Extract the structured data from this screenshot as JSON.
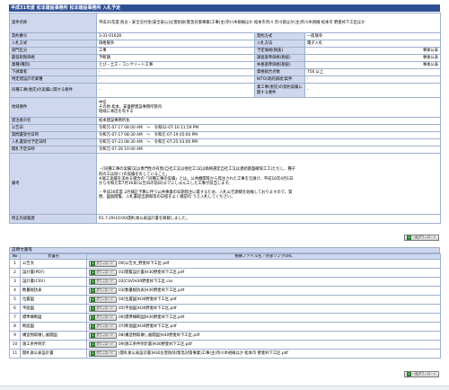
{
  "page_title": "平成31年度 松本建設事務所 松本建設事務所 入札予定",
  "rows": {
    "project_name_label": "案件名称",
    "project_name_value": "平成31年度 防災・安全交付金(安全安心)災害防除(緊急対策事業)工事(主)奈川木祖線ほか 松本市奈川 奈川渡ほか(主)奈川木祖線 松本市 野麦峠下工区ほか",
    "proc_no_label": "契約番号",
    "proc_no_value": "3-31-01628",
    "contract_method_label": "契約方式",
    "contract_method_value": "一般競争",
    "bid_type_label": "入札方式",
    "bid_type_value": "価格競争",
    "bid_method_label": "入札方法",
    "bid_method_value": "電子入札",
    "category_label": "部門区分",
    "category_value": "工事",
    "estimated_label": "予定価格(税抜)",
    "estimated_value": "",
    "estimated_note": "事後公表",
    "minimum_label": "最低制限価格",
    "minimum_value": "予断額",
    "survey_label": "調査基準価格(税抜)",
    "survey_note": "事後公表",
    "industry_label": "業種(種別)",
    "industry_value": "とび・土工・コンクリート工事",
    "lowlimit_label": "失格基準価格(税抜)",
    "lowlimit_note": "事後公表",
    "place_label": "下請業者",
    "place_value": "-",
    "qualification_label": "資格総合点数",
    "qualification_value": "756 以上",
    "special_label": "特定建設許可業種",
    "special_value": "-",
    "wto_label": "WTO(政府調達)案件",
    "wto_value": "-",
    "jv_label": "同種工事(委託)の実績に関する要件",
    "jv_value": "-",
    "jv2_label": "業工事(委託)の契約実績に関する要件",
    "jv2_value": "-",
    "region_label": "地域要件",
    "region_value": "中信\nその他 松本、安曇野建設事務所管内\n地域に本店を有する",
    "publisher_label": "発注者の名",
    "publisher_value": "松本建設事務所長",
    "announce_label": "公告日",
    "announce_value": "令和元-07-17 08:00 AM　〜　令和02-07-16 11:59 PM",
    "question_label": "質問書受付日時",
    "question_value": "令和元-07-17 08:30 AM　〜　令和元-07-19 05:00 PM",
    "bid_receive_label": "入札書受付予定日時",
    "bid_receive_value": "令和元-07-23 08:30 AM　〜　令和元-07-25 03:00 PM",
    "open_label": "開札予定日時",
    "open_value": "令和元-07-26 10:00 AM",
    "remarks_label": "備考",
    "remarks_value": "・[同種工事の実績]又は専門性の有無(自社工又は他社工)又は価格選定自社工又は連続基盤確保工工(ただし、種子的の工は除く)の実績を有していること。\n※施工実績を求める場合の「同種工事の実績」とは、公共機関等から発注された工事を元請け、平成16年4月1日から令和元年7月16日(公告日の前日)までにしゅん工した工事が該当します。\n\n・平成30年度 2月補正予算に伴う公共事業の早期発注に資するため、入札公告期間を短縮しておりますので、質問、図面閲覧、入札書提出期限等の日程をよく確認の うえ入札してください。",
    "modified_label": "修正内容履歴",
    "modified_value": "R1.7.29(10:00)開札後公表設計書を掲載しました。"
  },
  "docs": {
    "section_title": "説明文書等",
    "bulk_download_label": "一括ダウンロード",
    "col_no": "No",
    "col_title": "文書名",
    "col_file": "格納ファイル名／外部リンクURL",
    "download_label": "ダウンロード",
    "items": [
      {
        "no": "1",
        "title": "公告文",
        "file": "00[公告文_野麦峠下工区.pdf"
      },
      {
        "no": "2",
        "title": "設計書(PDF)",
        "file": "01[閲覧設計書]H30野麦峠下工区.pdf"
      },
      {
        "no": "3",
        "title": "設計書(CSV)",
        "file": "02[CSV]H30野麦峠下工区.csv"
      },
      {
        "no": "4",
        "title": "数量総括表",
        "file": "03[数量総括表]H30野麦峠下工区.pdf"
      },
      {
        "no": "5",
        "title": "位置図",
        "file": "04[位置図]H30野麦峠下工区.pdf"
      },
      {
        "no": "6",
        "title": "平面図",
        "file": "05[平面図]H30野麦峠下工区.pdf"
      },
      {
        "no": "7",
        "title": "標準横断図",
        "file": "06[標準横断図]H30野麦峠下工区.pdf"
      },
      {
        "no": "8",
        "title": "断面図",
        "file": "07[断面図]H30野麦峠下工区.pdf"
      },
      {
        "no": "9",
        "title": "構造物取壊し展開図",
        "file": "08[構造物取壊し展開図]H30野麦峠下工区.pdf"
      },
      {
        "no": "10",
        "title": "施工条件明示",
        "file": "09[施工条件明示書]H30野麦峠下工区.pdf"
      },
      {
        "no": "11",
        "title": "開札後公表設計書",
        "file": "[開札後公表設計書]H30災害防除(緊急対策事業)工事(主)奈川木祖線ほか 松本市 野麦峠下工区.pdf"
      }
    ]
  }
}
